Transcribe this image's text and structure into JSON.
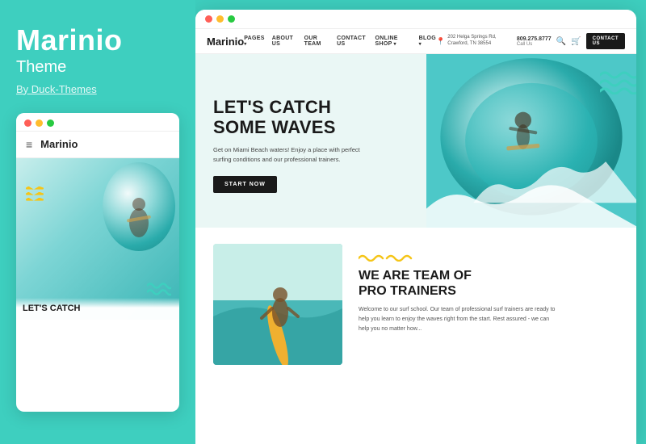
{
  "sidebar": {
    "title": "Marinio",
    "subtitle": "Theme",
    "byline": "By Duck-Themes",
    "mini_browser": {
      "nav_brand": "Marinio",
      "hero_heading_line1": "LET'S CATCH"
    }
  },
  "main": {
    "nav": {
      "brand": "Marinio",
      "links": [
        "PAGES",
        "ABOUT US",
        "OUR TEAM",
        "CONTACT US",
        "ONLINE SHOP",
        "BLOG"
      ],
      "address": "202 Helga Springs Rd, Crawford, TN 38554",
      "phone": "809.275.8777",
      "phone_label": "Call Us",
      "contact_btn": "CONTACT US"
    },
    "hero": {
      "heading_line1": "LET'S CATCH",
      "heading_line2": "SOME WAVES",
      "subtext": "Get on Miami Beach waters! Enjoy a place with perfect surfing conditions and our professional trainers.",
      "cta": "START NOW"
    },
    "section2": {
      "heading_line1": "WE ARE TEAM OF",
      "heading_line2": "PRO TRAINERS",
      "text": "Welcome to our surf school. Our team of professional surf trainers are ready to help you learn to enjoy the waves right from the start. Rest assured - we can help you no matter how..."
    }
  },
  "colors": {
    "teal": "#3ecfbf",
    "yellow": "#f5c518",
    "dark": "#1a1a1a",
    "white": "#ffffff"
  },
  "traffic_lights": {
    "red": "#ff5f57",
    "yellow": "#ffbd2e",
    "green": "#28ca41"
  }
}
